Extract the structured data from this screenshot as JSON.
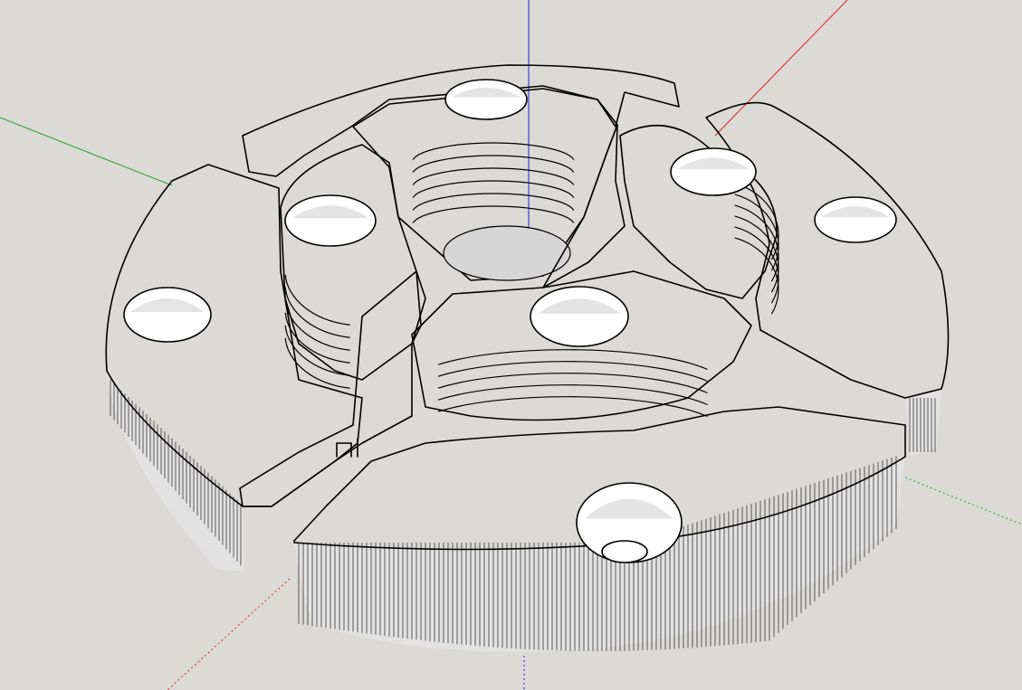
{
  "viewport": {
    "background_color": "#dcdad6",
    "model_face_color": "#ececec",
    "model_side_color": "#e2e2e2",
    "edge_color": "#000000"
  },
  "axes": {
    "red_axis_color": "#e02020",
    "green_axis_color": "#20a020",
    "blue_axis_color": "#2020d0"
  },
  "model": {
    "name_icon": "four-jaw-chuck-model",
    "jaw_count": 4,
    "mounting_hole_count": 4
  }
}
